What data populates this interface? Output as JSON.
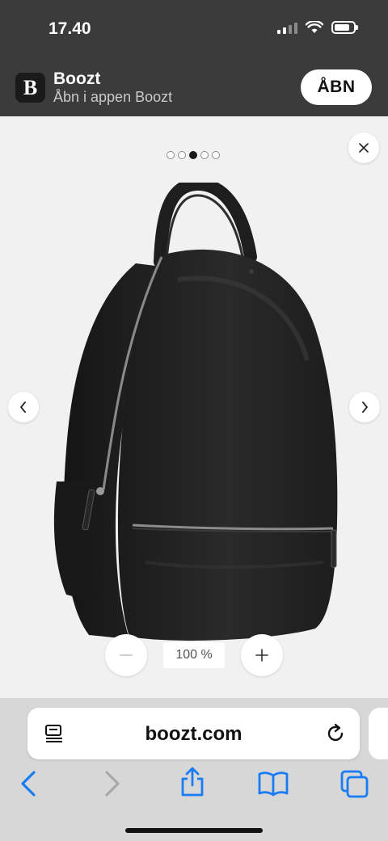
{
  "status_bar": {
    "time": "17.40"
  },
  "banner": {
    "logo_letter": "B",
    "app_name": "Boozt",
    "subtitle": "Åbn i appen Boozt",
    "open_label": "ÅBN"
  },
  "viewer": {
    "image_count": 5,
    "active_image_index": 2,
    "zoom_level": "100 %",
    "product_image": "black leather backpack"
  },
  "browser": {
    "url": "boozt.com",
    "toolbar": [
      "back-icon",
      "forward-icon",
      "share-icon",
      "bookmarks-icon",
      "tabs-icon"
    ],
    "accent_color": "#1a7cf5"
  },
  "colors": {
    "banner_bg": "#3b3b3b",
    "viewer_bg": "#f1f1f1",
    "browser_bg": "#d7d7d7"
  }
}
